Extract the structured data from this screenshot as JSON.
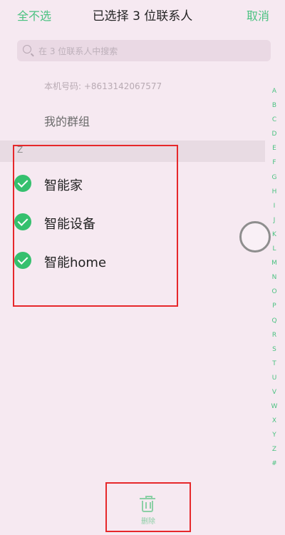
{
  "header": {
    "select_all": "全不选",
    "title": "已选择 3 位联系人",
    "cancel": "取消"
  },
  "search": {
    "placeholder": "在 3 位联系人中搜索"
  },
  "my_number": "本机号码: +8613142067577",
  "groups_label": "我的群组",
  "section": {
    "letter": "Z",
    "contacts": [
      {
        "name": "智能家",
        "selected": true
      },
      {
        "name": "智能设备",
        "selected": true
      },
      {
        "name": "智能home",
        "selected": true
      }
    ]
  },
  "alphabet": [
    "A",
    "B",
    "C",
    "D",
    "E",
    "F",
    "G",
    "H",
    "I",
    "J",
    "K",
    "L",
    "M",
    "N",
    "O",
    "P",
    "Q",
    "R",
    "S",
    "T",
    "U",
    "V",
    "W",
    "X",
    "Y",
    "Z",
    "#"
  ],
  "bottom": {
    "delete_label": "删除"
  },
  "colors": {
    "accent": "#4bc281",
    "check": "#35c06e",
    "highlight": "#e6282b",
    "background": "#f6e9f1"
  }
}
